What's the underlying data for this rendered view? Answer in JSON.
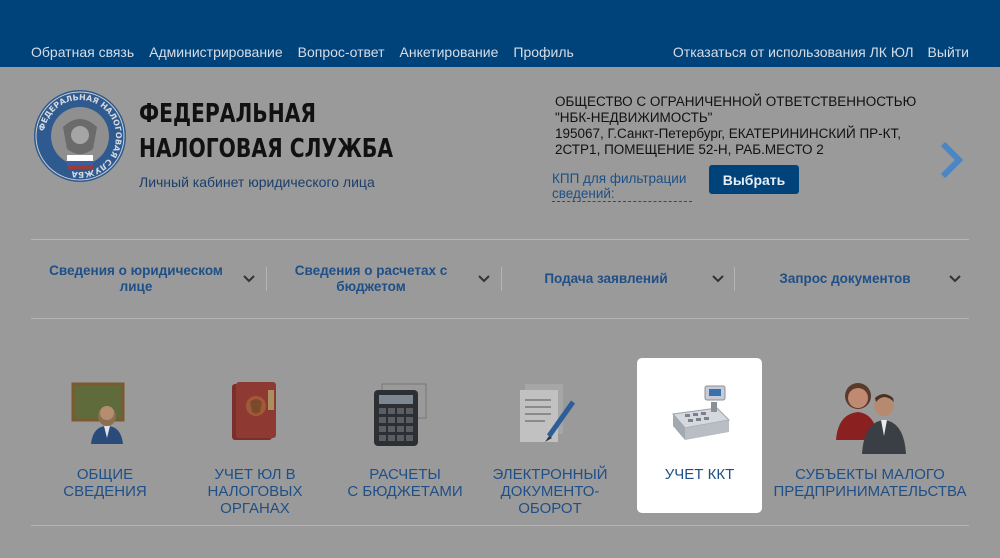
{
  "topnav": {
    "items": [
      "Обратная связь",
      "Администрирование",
      "Вопрос-ответ",
      "Анкетирование",
      "Профиль"
    ],
    "right_items": [
      "Отказаться от использования ЛК ЮЛ",
      "Выйти"
    ]
  },
  "header": {
    "title_line1": "ФЕДЕРАЛЬНАЯ",
    "title_line2": "НАЛОГОВАЯ СЛУЖБА",
    "subtitle": "Личный кабинет юридического лица",
    "emblem_text": "ФЕДЕРАЛЬНАЯ НАЛОГОВАЯ СЛУЖБА"
  },
  "company": {
    "line1": "ОБЩЕСТВО С ОГРАНИЧЕННОЙ ОТВЕТСТВЕННОСТЬЮ",
    "line2": "\"НБК-НЕДВИЖИМОСТЬ\"",
    "line3": "195067, Г.Санкт-Петербург, ЕКАТЕРИНИНСКИЙ ПР-КТ,",
    "line4": "2СТР1, ПОМЕЩЕНИЕ 52-Н, РАБ.МЕСТО 2",
    "kpp_link_line1": "КПП для фильтрации",
    "kpp_link_line2": "сведений:",
    "select_button": "Выбрать"
  },
  "menu": {
    "items": [
      {
        "line1": "Сведения о юридическом",
        "line2": "лице"
      },
      {
        "line1": "Сведения о расчетах с",
        "line2": "бюджетом"
      },
      {
        "line1": "Подача заявлений",
        "line2": ""
      },
      {
        "line1": "Запрос документов",
        "line2": ""
      }
    ]
  },
  "tiles": [
    {
      "lines": [
        "ОБЩИЕ",
        "СВЕДЕНИЯ"
      ],
      "icon": "teacher-board-icon"
    },
    {
      "lines": [
        "УЧЕТ ЮЛ В",
        "НАЛОГОВЫХ",
        "ОРГАНАХ"
      ],
      "icon": "red-folder-emblem-icon"
    },
    {
      "lines": [
        "РАСЧЕТЫ",
        "С БЮДЖЕТАМИ"
      ],
      "icon": "calculator-icon"
    },
    {
      "lines": [
        "ЭЛЕКТРОННЫЙ",
        "ДОКУМЕНТО-",
        "ОБОРОТ"
      ],
      "icon": "document-pen-icon"
    },
    {
      "lines": [
        "УЧЕТ ККТ"
      ],
      "icon": "cash-register-icon",
      "active": true
    },
    {
      "lines": [
        "СУБЪЕКТЫ МАЛОГО",
        "ПРЕДПРИНИМАТЕЛЬСТВА"
      ],
      "icon": "two-people-icon"
    }
  ],
  "colors": {
    "topbar": "#00427a",
    "overlay_bg": "#9a9a9a",
    "link": "#1f4f87",
    "accent_arrow": "#4a86c4"
  }
}
